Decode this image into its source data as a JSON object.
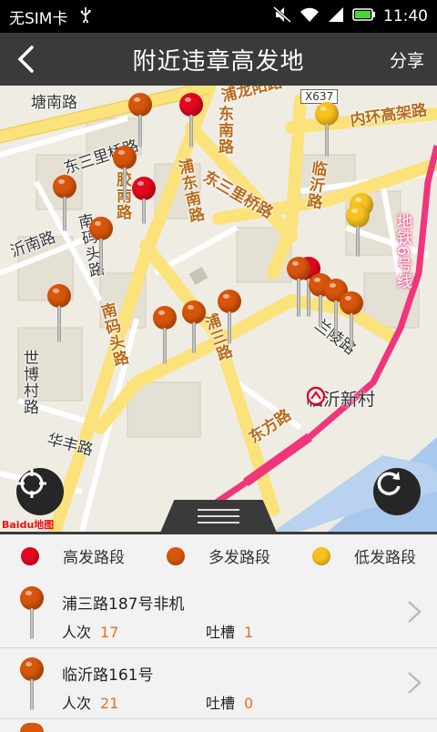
{
  "status_bar": {
    "carrier": "无SIM卡",
    "time": "11:40",
    "icons": [
      "usb-icon",
      "mute-icon",
      "wifi-icon",
      "signal-icon",
      "battery-icon"
    ]
  },
  "header": {
    "title": "附近违章高发地",
    "share_label": "分享",
    "back_icon": "back-arrow-icon"
  },
  "map": {
    "road_labels": {
      "tangnan": "塘南路",
      "pulongyang": "浦龙阳路",
      "donghuan": "内环高架路",
      "x637": "X637",
      "dongnan": "东南路",
      "dongsanliqiao_top": "东三里桥路",
      "dongsanliqiao_right": "东三里桥路",
      "jiaonan": "胶南路",
      "pudongnan": "浦东南路",
      "linyilu": "临沂路",
      "yinan": "沂南路",
      "nanmatou_upper": "南码头路",
      "nanmatou_lower": "南码头路",
      "metro": "地铁6号线",
      "pusan": "浦三路",
      "lanling": "兰陵路",
      "shibo": "世博村路",
      "huafeng": "华丰路",
      "dongfang": "东方路",
      "station": "临沂新村"
    },
    "logo_text": "Baidu地图",
    "locate_button": "locate-icon",
    "refresh_button": "refresh-icon"
  },
  "legend": {
    "high": "高发路段",
    "medium": "多发路段",
    "low": "低发路段",
    "colors": {
      "high": "#e3081e",
      "medium": "#d8560b",
      "low": "#f7c21e"
    }
  },
  "list": {
    "count_label": "人次",
    "complain_label": "吐槽",
    "items": [
      {
        "address": "浦三路187号非机",
        "count": "17",
        "complaints": "1",
        "level": "medium"
      },
      {
        "address": "临沂路161号",
        "count": "21",
        "complaints": "0",
        "level": "medium"
      }
    ]
  },
  "colors": {
    "accent": "#3a3a3a",
    "number": "#e3731b",
    "road_major": "#fbe27a",
    "road_metro": "#f0357b"
  }
}
